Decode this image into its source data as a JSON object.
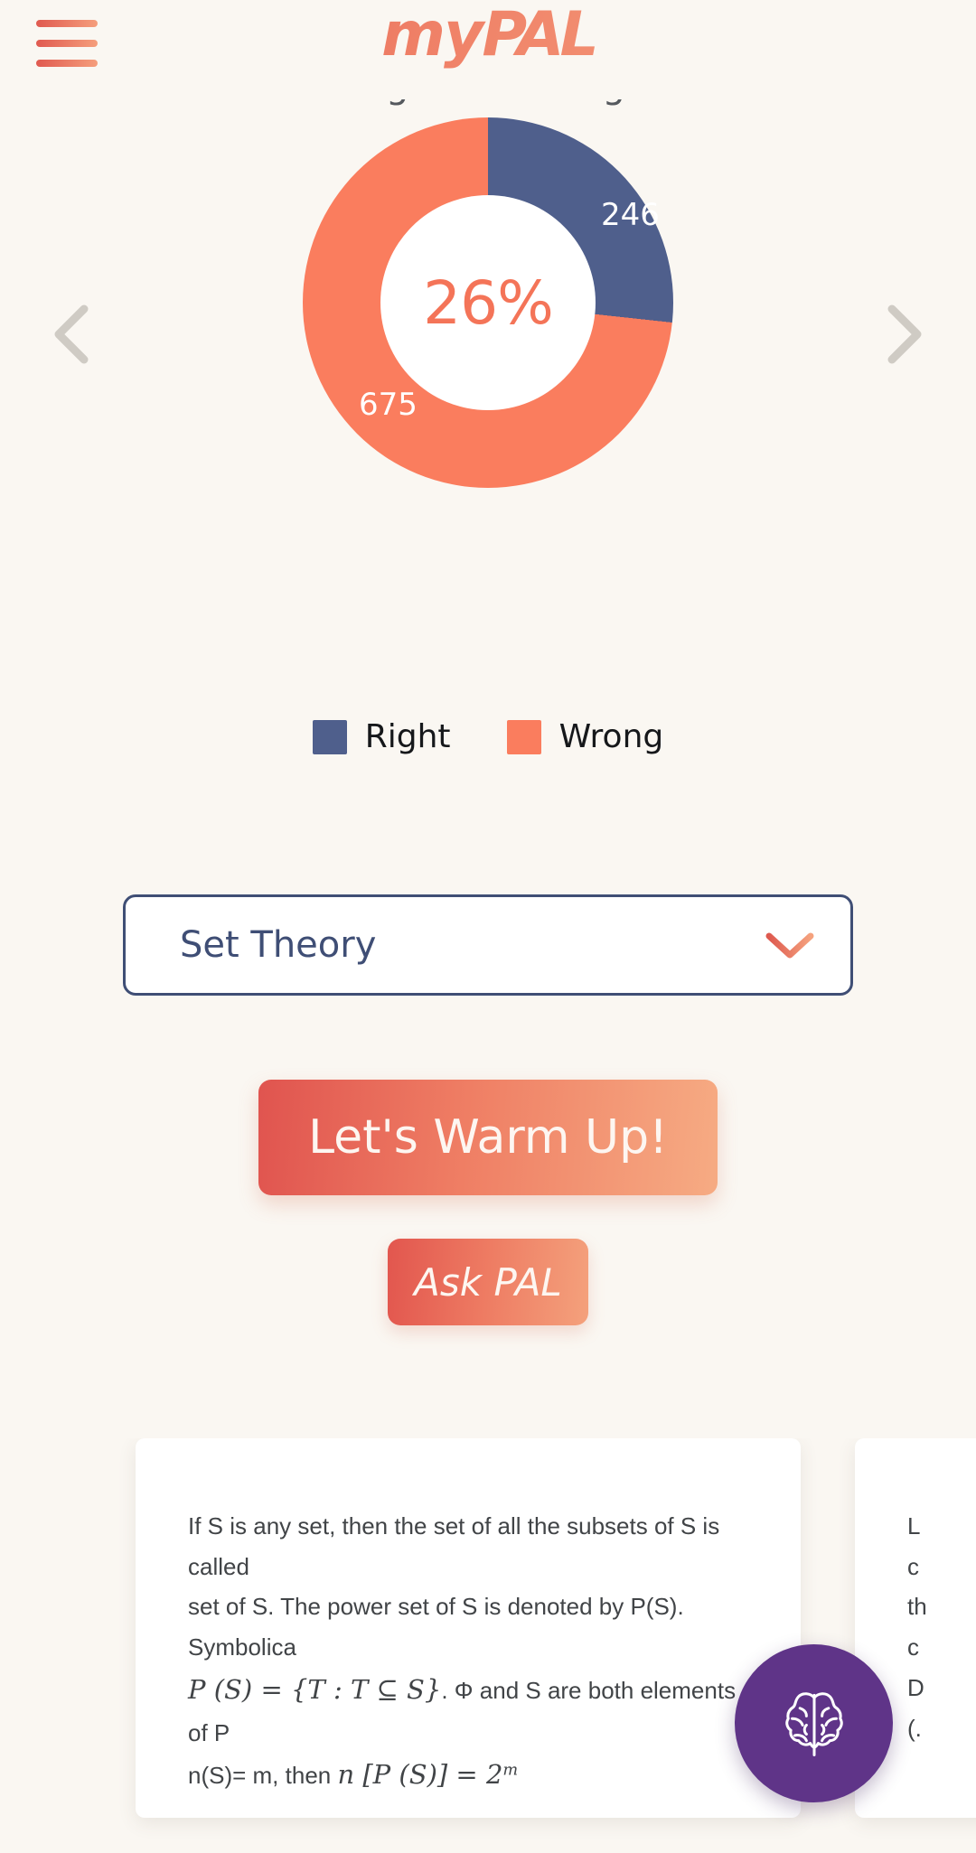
{
  "header": {
    "logo_text_my": "my",
    "logo_text_pal": "PAL",
    "menu_icon": "hamburger-menu-icon"
  },
  "chart_data": {
    "type": "pie",
    "variant": "donut",
    "title": "Right vs Wrong",
    "categories": [
      "Right",
      "Wrong"
    ],
    "values": [
      246,
      675
    ],
    "labels": [
      "246",
      "675"
    ],
    "colors": [
      "#4f5f8c",
      "#fa7d5e"
    ],
    "center_label": "26%",
    "center_label_color": "#f47458",
    "legend_position": "bottom",
    "grid": false,
    "xlabel": "",
    "ylabel": ""
  },
  "carousel": {
    "prev_label": "‹",
    "next_label": "›"
  },
  "topic_select": {
    "value": "Set Theory",
    "chevron": "chevron-down-icon"
  },
  "actions": {
    "warm_up_label": "Let's Warm Up!",
    "ask_pal_label": "Ask PAL"
  },
  "cards": [
    {
      "line1": "If S is any set, then the set of all the subsets of S is called",
      "line2": "set of S. The power set of S is denoted by P(S). Symbolica",
      "math1_lead": "P (S) = {T : T ⊆ S}",
      "math1_tail": ". Φ and S are both elements of P",
      "line4_lead": "n(S)= m, then",
      "math2": "n  [P (S)]  =  2",
      "math2_sup": "m"
    },
    {
      "line1": "L",
      "line2": "c",
      "line3": "th",
      "line4": "c",
      "line5": "D",
      "line6": "(."
    }
  ],
  "fab": {
    "icon": "brain-icon",
    "color": "#5f3488"
  }
}
